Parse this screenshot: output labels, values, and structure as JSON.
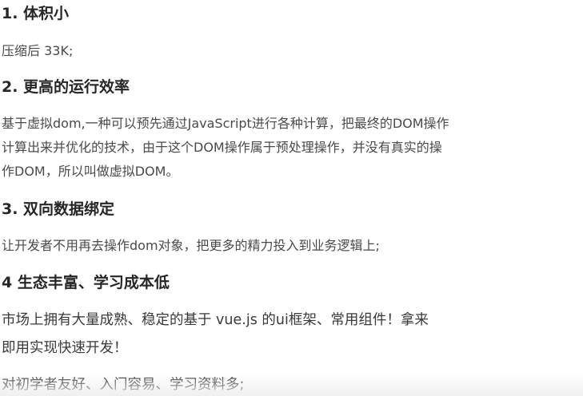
{
  "sections": [
    {
      "heading": "1. 体积小",
      "paragraphs": [
        {
          "lines": [
            "压缩后 33K;"
          ]
        }
      ]
    },
    {
      "heading": "2. 更高的运行效率",
      "paragraphs": [
        {
          "lines": [
            "基于虚拟dom,一种可以预先通过JavaScript进行各种计算，把最终的DOM操作",
            "计算出来并优化的技术，由于这个DOM操作属于预处理操作，并没有真实的操",
            "作DOM，所以叫做虚拟DOM。"
          ]
        }
      ]
    },
    {
      "heading": "3. 双向数据绑定",
      "paragraphs": [
        {
          "lines": [
            "让开发者不用再去操作dom对象，把更多的精力投入到业务逻辑上;"
          ]
        }
      ]
    },
    {
      "heading": "4 生态丰富、学习成本低",
      "paragraphs": [
        {
          "lines": [
            "市场上拥有大量成熟、稳定的基于 vue.js 的ui框架、常用组件！拿来",
            "即用实现快速开发！"
          ]
        },
        {
          "lines": [
            "对初学者友好、入门容易、学习资料多;"
          ]
        }
      ]
    }
  ]
}
